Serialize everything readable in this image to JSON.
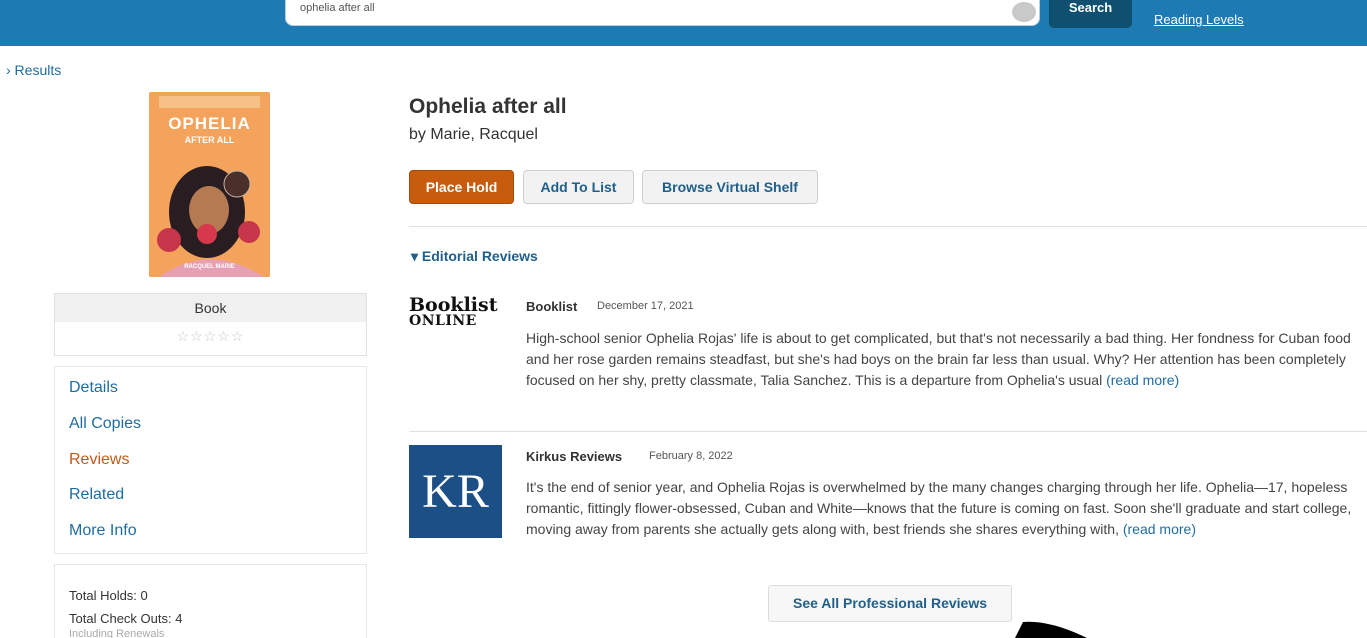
{
  "header": {
    "search_value": "ophelia after all",
    "search_button": "Search",
    "reading_levels": "Reading Levels"
  },
  "breadcrumb": {
    "results": "› Results"
  },
  "sidebar": {
    "format": "Book",
    "rating_stars": "☆☆☆☆☆",
    "nav": [
      {
        "label": "Details"
      },
      {
        "label": "All Copies"
      },
      {
        "label": "Reviews"
      },
      {
        "label": "Related"
      },
      {
        "label": "More Info"
      }
    ],
    "stats": {
      "total_holds": "Total Holds: 0",
      "total_checkouts": "Total Check Outs: 4",
      "including_renewals": "Including Renewals"
    }
  },
  "book": {
    "title": "Ophelia after all",
    "author": "by Marie, Racquel",
    "cover_title_line1": "OPHELIA",
    "cover_title_line2": "AFTER ALL",
    "cover_author": "RACQUEL MARIE"
  },
  "actions": {
    "place_hold": "Place Hold",
    "add_to_list": "Add To List",
    "browse_virtual_shelf": "Browse Virtual Shelf"
  },
  "editorial_reviews": {
    "heading": "▾ Editorial Reviews",
    "items": [
      {
        "logo_line1": "Booklist",
        "logo_line2": "ONLINE",
        "source": "Booklist",
        "date": "December 17, 2021",
        "text": "High-school senior Ophelia Rojas' life is about to get complicated, but that's not necessarily a bad thing. Her fondness for Cuban food and her rose garden remains steadfast, but she's had boys on the brain far less than usual. Why? Her attention has been completely focused on her shy, pretty classmate, Talia Sanchez. This is a departure from Ophelia's usual",
        "read_more": "(read more)"
      },
      {
        "logo": "KR",
        "source": "Kirkus Reviews",
        "date": "February 8, 2022",
        "text": "It's the end of senior year, and Ophelia Rojas is overwhelmed by the many changes charging through her life. Ophelia—17, hopeless romantic, fittingly flower-obsessed, Cuban and White—knows that the future is coming on fast. Soon she'll graduate and start college, moving away from parents she actually gets along with, best friends she shares everything with,",
        "read_more": "(read more)"
      }
    ],
    "see_all": "See All Professional Reviews"
  },
  "colors": {
    "header_blue": "#1d7ab3",
    "accent_orange": "#c75c0f",
    "link_blue": "#1f6da0",
    "kirkus_blue": "#1c4f86"
  }
}
